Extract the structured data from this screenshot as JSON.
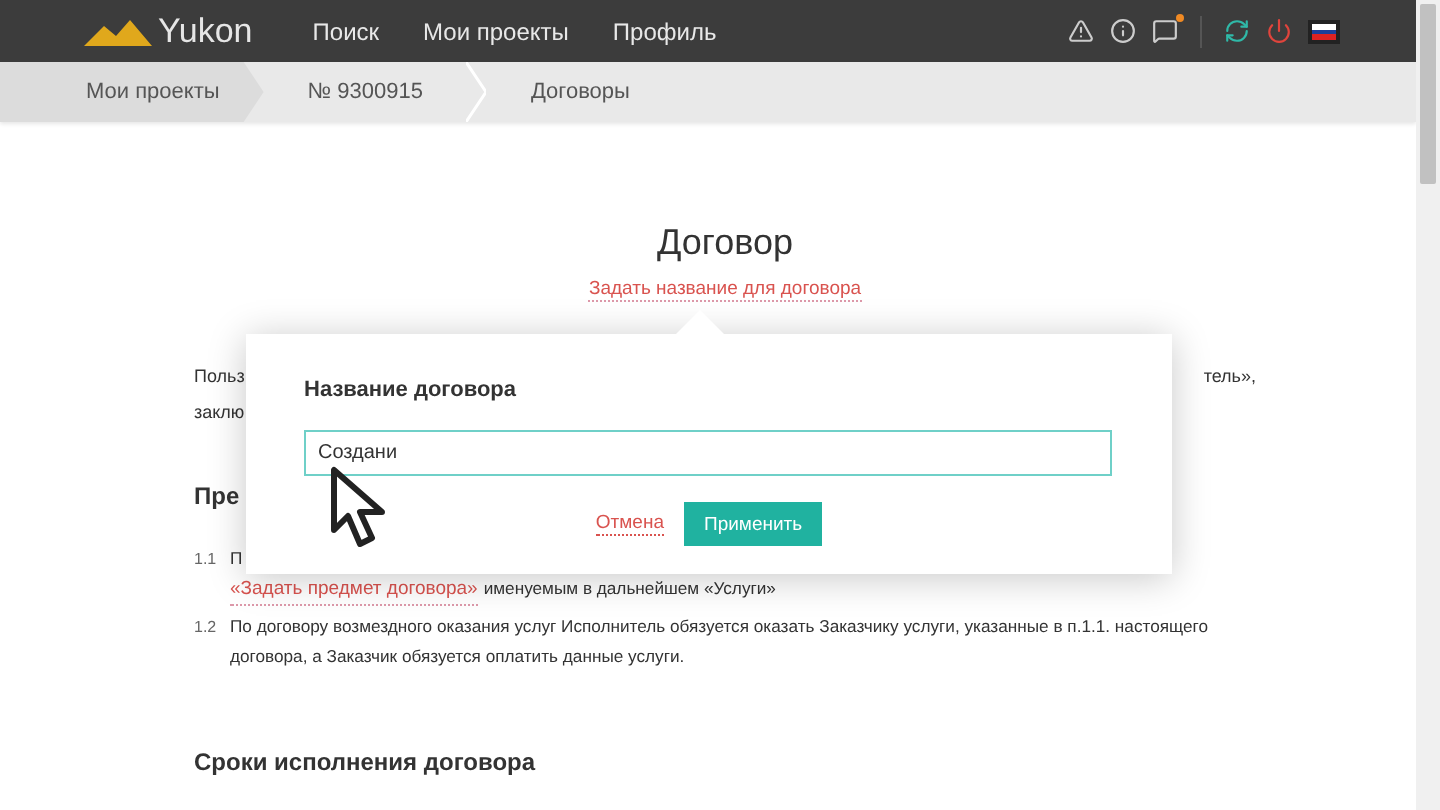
{
  "header": {
    "logo": "Yukon",
    "nav": [
      {
        "label": "Поиск"
      },
      {
        "label": "Мои проекты"
      },
      {
        "label": "Профиль"
      }
    ],
    "messages_unread": true
  },
  "breadcrumbs": [
    {
      "label": "Мои проекты"
    },
    {
      "label": "№ 9300915"
    },
    {
      "label": "Договоры"
    }
  ],
  "document": {
    "title": "Договор",
    "title_link": "Задать название для договора",
    "intro": [
      {
        "left": "Польз",
        "right": "тель»,"
      },
      {
        "left": "заклю"
      }
    ],
    "section_1": {
      "heading": "Пре",
      "items": [
        {
          "number": "1.1",
          "text": "П",
          "link": "«Задать предмет договора»",
          "rest": "именуемым в дальнейшем «Услуги»"
        },
        {
          "number": "1.2",
          "text": "По договору возмездного оказания услуг Исполнитель обязуется оказать Заказчику услуги, указанные в п.1.1. настоящего договора, а Заказчик обязуется оплатить данные услуги."
        }
      ]
    },
    "section_2": {
      "heading": "Сроки исполнения договора"
    }
  },
  "popup": {
    "title": "Название договора",
    "value": "Создани",
    "cancel": "Отмена",
    "apply": "Применить"
  }
}
